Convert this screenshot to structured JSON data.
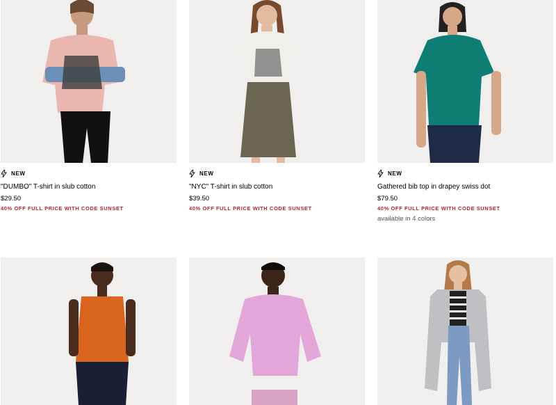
{
  "products": [
    {
      "badge": "NEW",
      "name": "\"DUMBO\" T-shirt in slub cotton",
      "price": "$29.50",
      "promo": "40% OFF FULL PRICE WITH CODE SUNSET",
      "colors": ""
    },
    {
      "badge": "NEW",
      "name": "\"NYC\" T-shirt in slub cotton",
      "price": "$39.50",
      "promo": "40% OFF FULL PRICE WITH CODE SUNSET",
      "colors": ""
    },
    {
      "badge": "NEW",
      "name": "Gathered bib top in drapey swiss dot",
      "price": "$79.50",
      "promo": "40% OFF FULL PRICE WITH CODE SUNSET",
      "colors": "available in 4 colors"
    },
    {
      "badge": "",
      "name": "",
      "price": "",
      "promo": "",
      "colors": ""
    },
    {
      "badge": "",
      "name": "",
      "price": "",
      "promo": "",
      "colors": ""
    },
    {
      "badge": "",
      "name": "",
      "price": "",
      "promo": "",
      "colors": ""
    }
  ],
  "icons": {
    "badge_icon": "lightning-icon"
  },
  "colors": {
    "promo": "#c41e1e",
    "photo_bg": "#f0efed"
  }
}
